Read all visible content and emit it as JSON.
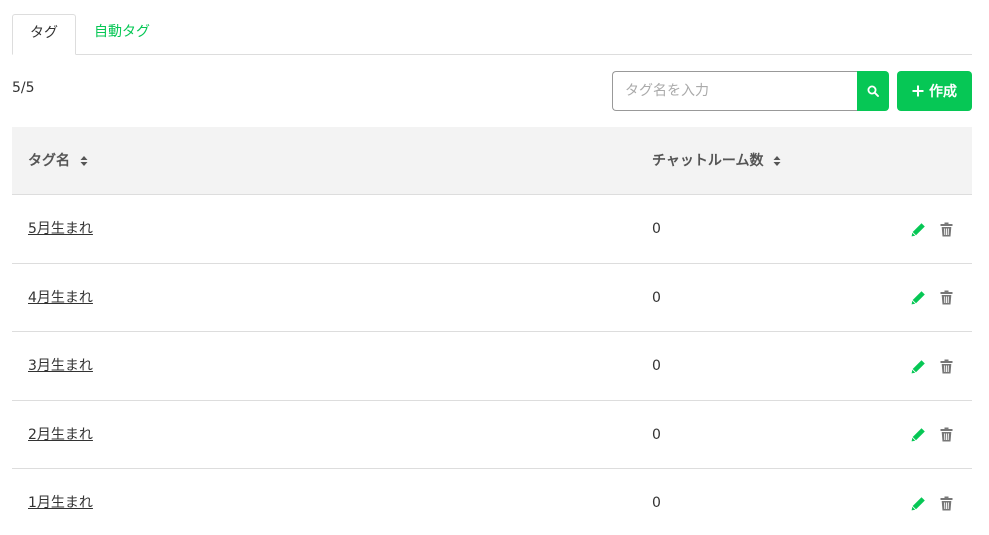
{
  "tabs": [
    {
      "label": "タグ",
      "active": true
    },
    {
      "label": "自動タグ",
      "active": false
    }
  ],
  "count": "5/5",
  "search": {
    "placeholder": "タグ名を入力",
    "value": "",
    "icon": "search-icon"
  },
  "create_button": {
    "label": "作成",
    "icon": "plus-icon"
  },
  "table": {
    "headers": {
      "name": "タグ名",
      "rooms": "チャットルーム数"
    },
    "rows": [
      {
        "name": "5月生まれ",
        "rooms": "0"
      },
      {
        "name": "4月生まれ",
        "rooms": "0"
      },
      {
        "name": "3月生まれ",
        "rooms": "0"
      },
      {
        "name": "2月生まれ",
        "rooms": "0"
      },
      {
        "name": "1月生まれ",
        "rooms": "0"
      }
    ]
  },
  "colors": {
    "accent": "#06c755",
    "trash": "#777777",
    "header_bg": "#f3f3f3"
  }
}
